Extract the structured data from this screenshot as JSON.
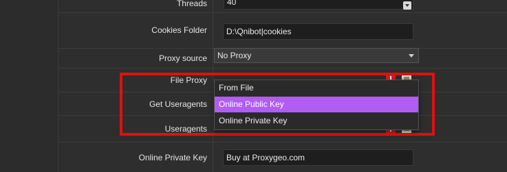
{
  "form": {
    "threads": {
      "label": "Threads",
      "value": "40"
    },
    "cookies_folder": {
      "label": "Cookies Folder",
      "value": "D:\\Qnibot|cookies"
    },
    "proxy_source": {
      "label": "Proxy source",
      "value": "No Proxy"
    },
    "file_proxy": {
      "label": "File Proxy"
    },
    "get_useragents": {
      "label": "Get Useragents"
    },
    "useragents": {
      "label": "Useragents"
    },
    "online_private_key": {
      "label": "Online Private Key",
      "value": "Buy at Proxygeo.com"
    }
  },
  "dropdown": {
    "options": [
      {
        "label": "From File",
        "selected": false
      },
      {
        "label": "Online Public Key",
        "selected": true
      },
      {
        "label": "Online Private Key",
        "selected": false
      }
    ]
  },
  "colors": {
    "highlight_frame": "#e01010",
    "selected_option": "#b05df0",
    "background": "#2e2e2e"
  },
  "icons": {
    "spin": "chevron-down-icon",
    "clear": "clear-icon",
    "browse": "folder-icon"
  }
}
